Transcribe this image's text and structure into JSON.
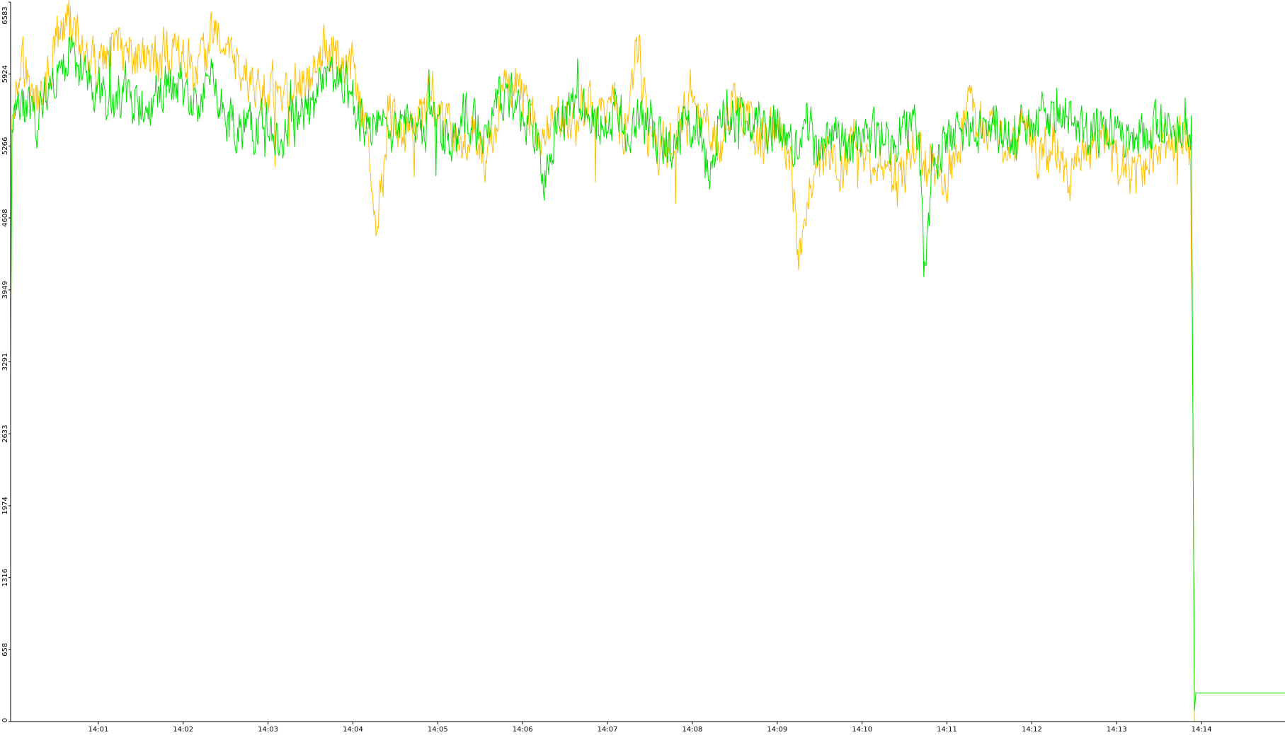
{
  "chart_data": {
    "type": "line",
    "title": "",
    "xlabel": "",
    "ylabel": "",
    "grid": false,
    "legend": "none",
    "ylim": [
      0,
      6583
    ],
    "yticks": [
      "0",
      "658",
      "1316",
      "1974",
      "2633",
      "3291",
      "3949",
      "4608",
      "5266",
      "5924",
      "6583"
    ],
    "xlim": [
      "13:59:58",
      "14:14:59"
    ],
    "xticks": [
      {
        "time": "14:01:00",
        "label": "14:01"
      },
      {
        "time": "14:02:00",
        "label": "14:02"
      },
      {
        "time": "14:03:00",
        "label": "14:03"
      },
      {
        "time": "14:04:00",
        "label": "14:04"
      },
      {
        "time": "14:05:00",
        "label": "14:05"
      },
      {
        "time": "14:06:00",
        "label": "14:06"
      },
      {
        "time": "14:07:00",
        "label": "14:07"
      },
      {
        "time": "14:08:00",
        "label": "14:08"
      },
      {
        "time": "14:09:00",
        "label": "14:09"
      },
      {
        "time": "14:10:00",
        "label": "14:10"
      },
      {
        "time": "14:11:00",
        "label": "14:11"
      },
      {
        "time": "14:12:00",
        "label": "14:12"
      },
      {
        "time": "14:13:00",
        "label": "14:13"
      },
      {
        "time": "14:14:00",
        "label": "14:14"
      }
    ],
    "series": [
      {
        "color": "#ffc000",
        "points": [
          [
            "13:59:58",
            3300
          ],
          [
            "13:59:59",
            5600
          ],
          [
            "14:00:00",
            5700
          ],
          [
            "14:00:03",
            5900
          ],
          [
            "14:00:06",
            6100
          ],
          [
            "14:00:10",
            5850
          ],
          [
            "14:00:15",
            5650
          ],
          [
            "14:00:20",
            5700
          ],
          [
            "14:00:25",
            5900
          ],
          [
            "14:00:30",
            6250
          ],
          [
            "14:00:35",
            6450
          ],
          [
            "14:00:40",
            6380
          ],
          [
            "14:00:45",
            6200
          ],
          [
            "14:00:50",
            6150
          ],
          [
            "14:01:00",
            6000
          ],
          [
            "14:01:10",
            6200
          ],
          [
            "14:01:20",
            6050
          ],
          [
            "14:01:30",
            6100
          ],
          [
            "14:01:40",
            6050
          ],
          [
            "14:01:50",
            6120
          ],
          [
            "14:02:00",
            6050
          ],
          [
            "14:02:10",
            5950
          ],
          [
            "14:02:20",
            6250
          ],
          [
            "14:02:30",
            6300
          ],
          [
            "14:02:40",
            5900
          ],
          [
            "14:02:50",
            5750
          ],
          [
            "14:03:00",
            5700
          ],
          [
            "14:03:10",
            5850
          ],
          [
            "14:03:20",
            5800
          ],
          [
            "14:03:30",
            5900
          ],
          [
            "14:03:40",
            6150
          ],
          [
            "14:03:50",
            6100
          ],
          [
            "14:04:00",
            5950
          ],
          [
            "14:04:10",
            5400
          ],
          [
            "14:04:17",
            4450
          ],
          [
            "14:04:25",
            5550
          ],
          [
            "14:04:35",
            5350
          ],
          [
            "14:04:45",
            5500
          ],
          [
            "14:04:55",
            5750
          ],
          [
            "14:05:05",
            5500
          ],
          [
            "14:05:15",
            5250
          ],
          [
            "14:05:25",
            5450
          ],
          [
            "14:05:35",
            5150
          ],
          [
            "14:05:45",
            5650
          ],
          [
            "14:05:55",
            5850
          ],
          [
            "14:06:05",
            5600
          ],
          [
            "14:06:15",
            5300
          ],
          [
            "14:06:25",
            5550
          ],
          [
            "14:06:35",
            5400
          ],
          [
            "14:06:45",
            5650
          ],
          [
            "14:06:55",
            5700
          ],
          [
            "14:07:05",
            5650
          ],
          [
            "14:07:15",
            5450
          ],
          [
            "14:07:20",
            6300
          ],
          [
            "14:07:30",
            5300
          ],
          [
            "14:07:40",
            5250
          ],
          [
            "14:07:50",
            5450
          ],
          [
            "14:08:00",
            5600
          ],
          [
            "14:08:10",
            5500
          ],
          [
            "14:08:20",
            5250
          ],
          [
            "14:08:30",
            5700
          ],
          [
            "14:08:40",
            5500
          ],
          [
            "14:08:50",
            5300
          ],
          [
            "14:09:00",
            5550
          ],
          [
            "14:09:10",
            5150
          ],
          [
            "14:09:15",
            4200
          ],
          [
            "14:09:25",
            5050
          ],
          [
            "14:09:35",
            5200
          ],
          [
            "14:09:45",
            5050
          ],
          [
            "14:09:55",
            5400
          ],
          [
            "14:10:05",
            5100
          ],
          [
            "14:10:15",
            5200
          ],
          [
            "14:10:25",
            4850
          ],
          [
            "14:10:35",
            5300
          ],
          [
            "14:10:45",
            5150
          ],
          [
            "14:10:55",
            5050
          ],
          [
            "14:11:05",
            5050
          ],
          [
            "14:11:15",
            5600
          ],
          [
            "14:11:25",
            5450
          ],
          [
            "14:11:35",
            5400
          ],
          [
            "14:11:45",
            5200
          ],
          [
            "14:11:55",
            5500
          ],
          [
            "14:12:05",
            5150
          ],
          [
            "14:12:15",
            5300
          ],
          [
            "14:12:25",
            4950
          ],
          [
            "14:12:35",
            5250
          ],
          [
            "14:12:45",
            5350
          ],
          [
            "14:12:55",
            5300
          ],
          [
            "14:13:05",
            5050
          ],
          [
            "14:13:15",
            4950
          ],
          [
            "14:13:25",
            5200
          ],
          [
            "14:13:35",
            5300
          ],
          [
            "14:13:45",
            5400
          ],
          [
            "14:13:52",
            5250
          ],
          [
            "14:13:54",
            2750
          ],
          [
            "14:13:55",
            0
          ],
          [
            "14:14:59",
            0
          ]
        ]
      },
      {
        "color": "#00e000",
        "points": [
          [
            "13:59:58",
            3300
          ],
          [
            "13:59:59",
            5500
          ],
          [
            "14:00:00",
            5600
          ],
          [
            "14:00:05",
            5550
          ],
          [
            "14:00:10",
            5650
          ],
          [
            "14:00:15",
            5500
          ],
          [
            "14:00:20",
            5600
          ],
          [
            "14:00:25",
            5750
          ],
          [
            "14:00:30",
            5900
          ],
          [
            "14:00:35",
            6050
          ],
          [
            "14:00:40",
            6200
          ],
          [
            "14:00:45",
            6000
          ],
          [
            "14:00:50",
            5950
          ],
          [
            "14:01:00",
            5700
          ],
          [
            "14:01:10",
            5650
          ],
          [
            "14:01:20",
            5750
          ],
          [
            "14:01:30",
            5600
          ],
          [
            "14:01:40",
            5650
          ],
          [
            "14:01:50",
            5850
          ],
          [
            "14:02:00",
            5800
          ],
          [
            "14:02:10",
            5600
          ],
          [
            "14:02:20",
            5900
          ],
          [
            "14:02:30",
            5550
          ],
          [
            "14:02:40",
            5450
          ],
          [
            "14:02:50",
            5400
          ],
          [
            "14:03:00",
            5500
          ],
          [
            "14:03:10",
            5300
          ],
          [
            "14:03:20",
            5500
          ],
          [
            "14:03:30",
            5650
          ],
          [
            "14:03:40",
            5900
          ],
          [
            "14:03:50",
            5850
          ],
          [
            "14:04:00",
            5700
          ],
          [
            "14:04:10",
            5450
          ],
          [
            "14:04:20",
            5500
          ],
          [
            "14:04:30",
            5400
          ],
          [
            "14:04:40",
            5600
          ],
          [
            "14:04:50",
            5500
          ],
          [
            "14:05:00",
            5450
          ],
          [
            "14:05:10",
            5300
          ],
          [
            "14:05:20",
            5550
          ],
          [
            "14:05:30",
            5400
          ],
          [
            "14:05:40",
            5500
          ],
          [
            "14:05:50",
            5800
          ],
          [
            "14:06:00",
            5550
          ],
          [
            "14:06:10",
            5350
          ],
          [
            "14:06:15",
            4900
          ],
          [
            "14:06:25",
            5500
          ],
          [
            "14:06:35",
            5550
          ],
          [
            "14:06:45",
            5600
          ],
          [
            "14:06:55",
            5450
          ],
          [
            "14:07:05",
            5550
          ],
          [
            "14:07:15",
            5400
          ],
          [
            "14:07:25",
            5600
          ],
          [
            "14:07:35",
            5350
          ],
          [
            "14:07:45",
            5300
          ],
          [
            "14:07:55",
            5550
          ],
          [
            "14:08:05",
            5500
          ],
          [
            "14:08:12",
            4950
          ],
          [
            "14:08:20",
            5600
          ],
          [
            "14:08:30",
            5550
          ],
          [
            "14:08:40",
            5450
          ],
          [
            "14:08:50",
            5500
          ],
          [
            "14:09:00",
            5450
          ],
          [
            "14:09:10",
            5300
          ],
          [
            "14:09:20",
            5400
          ],
          [
            "14:09:30",
            5200
          ],
          [
            "14:09:40",
            5350
          ],
          [
            "14:09:50",
            5300
          ],
          [
            "14:10:00",
            5250
          ],
          [
            "14:10:10",
            5350
          ],
          [
            "14:10:20",
            5300
          ],
          [
            "14:10:30",
            5450
          ],
          [
            "14:10:40",
            5350
          ],
          [
            "14:10:44",
            4100
          ],
          [
            "14:10:50",
            5200
          ],
          [
            "14:11:00",
            5350
          ],
          [
            "14:11:10",
            5400
          ],
          [
            "14:11:20",
            5450
          ],
          [
            "14:11:30",
            5550
          ],
          [
            "14:11:40",
            5400
          ],
          [
            "14:11:50",
            5350
          ],
          [
            "14:12:00",
            5500
          ],
          [
            "14:12:10",
            5450
          ],
          [
            "14:12:20",
            5550
          ],
          [
            "14:12:30",
            5500
          ],
          [
            "14:12:40",
            5350
          ],
          [
            "14:12:50",
            5400
          ],
          [
            "14:13:00",
            5450
          ],
          [
            "14:13:10",
            5350
          ],
          [
            "14:13:20",
            5400
          ],
          [
            "14:13:30",
            5450
          ],
          [
            "14:13:40",
            5400
          ],
          [
            "14:13:50",
            5500
          ],
          [
            "14:13:53",
            5450
          ],
          [
            "14:13:55",
            100
          ],
          [
            "14:13:56",
            260
          ],
          [
            "14:14:59",
            260
          ]
        ]
      }
    ]
  }
}
